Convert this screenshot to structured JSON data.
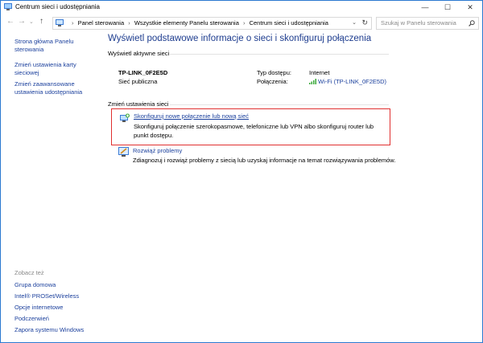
{
  "window": {
    "title": "Centrum sieci i udostępniania",
    "controls": {
      "minimize": "—",
      "maximize": "☐",
      "close": "✕"
    }
  },
  "address": {
    "crumbs": [
      "Panel sterowania",
      "Wszystkie elementy Panelu sterowania",
      "Centrum sieci i udostępniania"
    ],
    "separator": "›",
    "search_placeholder": "Szukaj w Panelu sterowania"
  },
  "sidebar": {
    "links": [
      {
        "label_line1": "Strona główna Panelu",
        "label_line2": "sterowania"
      },
      {
        "label_line1": "Zmień ustawienia karty",
        "label_line2": "sieciowej"
      },
      {
        "label_line1": "Zmień zaawansowane",
        "label_line2": "ustawienia udostępniania"
      }
    ],
    "see_also_label": "Zobacz też",
    "see_also": [
      "Grupa domowa",
      "Intel® PROSet/Wireless",
      "Opcje internetowe",
      "Podczerwień",
      "Zapora systemu Windows"
    ]
  },
  "main": {
    "title": "Wyświetl podstawowe informacje o sieci i skonfiguruj połączenia",
    "active_networks_label": "Wyświetl aktywne sieci",
    "network": {
      "name": "TP-LINK_0F2E5D",
      "category": "Sieć publiczna",
      "access_type_label": "Typ dostępu:",
      "access_type_value": "Internet",
      "connections_label": "Połączenia:",
      "connection_value": "Wi-Fi (TP-LINK_0F2E5D)"
    },
    "change_settings_label": "Zmień ustawienia sieci",
    "tasks": [
      {
        "link": "Skonfiguruj nowe połączenie lub nową sieć",
        "description": "Skonfiguruj połączenie szerokopasmowe, telefoniczne lub VPN albo skonfiguruj router lub punkt dostępu."
      },
      {
        "link": "Rozwiąż problemy",
        "description": "Zdiagnozuj i rozwiąż problemy z siecią lub uzyskaj informacje na temat rozwiązywania problemów."
      }
    ]
  },
  "icons": {
    "back": "back-arrow-icon",
    "forward": "forward-arrow-icon",
    "recent": "recent-pages-icon",
    "up": "up-arrow-icon",
    "refresh": "refresh-icon",
    "search": "search-icon"
  },
  "colors": {
    "link": "#1a3f9c",
    "title": "#1e3d8f",
    "highlight_border": "#e03030",
    "window_border": "#2b79d0"
  }
}
